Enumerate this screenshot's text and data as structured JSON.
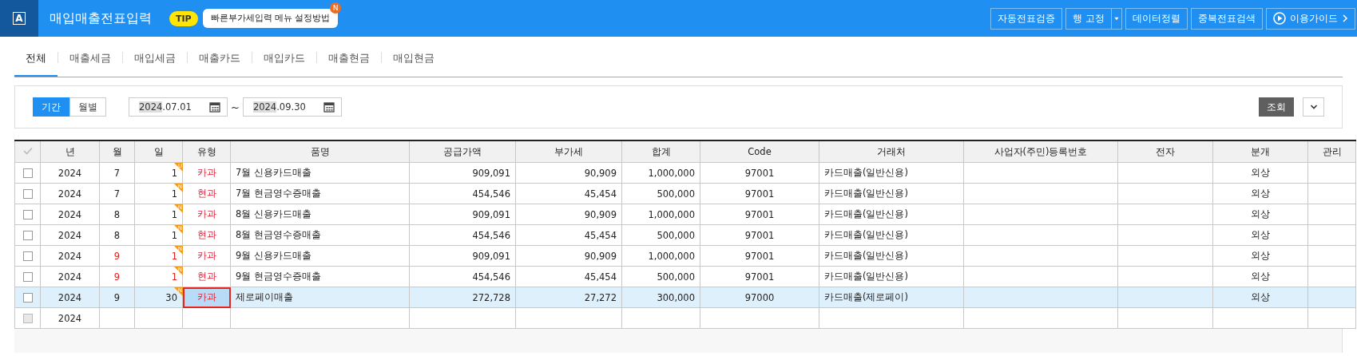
{
  "app": {
    "logo": "A",
    "title": "매입매출전표입력",
    "tip_badge": "TIP",
    "tip_text": "빠른부가세입력 메뉴 설정방법",
    "tip_new": "N"
  },
  "toolbar": [
    {
      "label": "자동전표검증",
      "kind": "button"
    },
    {
      "label": "행 고정",
      "kind": "split"
    },
    {
      "label": "데이터정렬",
      "kind": "button"
    },
    {
      "label": "중복전표검색",
      "kind": "button"
    },
    {
      "label": "이용가이드",
      "kind": "guide"
    }
  ],
  "tabs": [
    {
      "label": "전체",
      "selected": true
    },
    {
      "label": "매출세금",
      "selected": false
    },
    {
      "label": "매입세금",
      "selected": false
    },
    {
      "label": "매출카드",
      "selected": false
    },
    {
      "label": "매입카드",
      "selected": false
    },
    {
      "label": "매출현금",
      "selected": false
    },
    {
      "label": "매입현금",
      "selected": false
    }
  ],
  "period": {
    "modes": [
      {
        "label": "기간",
        "selected": true
      },
      {
        "label": "월별",
        "selected": false
      }
    ],
    "from": {
      "year": "2024",
      "rest": ".07.01"
    },
    "separator": "~",
    "to": {
      "year": "2024",
      "rest": ".09.30"
    },
    "search_button": "조회"
  },
  "table": {
    "columns": [
      "년",
      "월",
      "일",
      "유형",
      "품명",
      "공급가액",
      "부가세",
      "합계",
      "Code",
      "거래처",
      "사업자(주민)등록번호",
      "전자",
      "분개",
      "관리"
    ],
    "rows": [
      {
        "kind": "entry",
        "checked": false,
        "selected": false,
        "focused": false,
        "warn": false,
        "year": "2024",
        "month": "7",
        "day": "1",
        "flag": "U",
        "type": "카과",
        "item": "7월 신용카드매출",
        "supply": "909,091",
        "vat": "90,909",
        "total": "1,000,000",
        "code": "97001",
        "partner": "카드매출(일반신용)",
        "journal": "외상"
      },
      {
        "kind": "entry",
        "checked": false,
        "selected": false,
        "focused": false,
        "warn": false,
        "year": "2024",
        "month": "7",
        "day": "1",
        "flag": "N",
        "type": "현과",
        "item": "7월 현금영수증매출",
        "supply": "454,546",
        "vat": "45,454",
        "total": "500,000",
        "code": "97001",
        "partner": "카드매출(일반신용)",
        "journal": "외상"
      },
      {
        "kind": "entry",
        "checked": false,
        "selected": false,
        "focused": false,
        "warn": false,
        "year": "2024",
        "month": "8",
        "day": "1",
        "flag": "N",
        "type": "카과",
        "item": "8월 신용카드매출",
        "supply": "909,091",
        "vat": "90,909",
        "total": "1,000,000",
        "code": "97001",
        "partner": "카드매출(일반신용)",
        "journal": "외상"
      },
      {
        "kind": "entry",
        "checked": false,
        "selected": false,
        "focused": false,
        "warn": false,
        "year": "2024",
        "month": "8",
        "day": "1",
        "flag": "N",
        "type": "현과",
        "item": "8월 현금영수증매출",
        "supply": "454,546",
        "vat": "45,454",
        "total": "500,000",
        "code": "97001",
        "partner": "카드매출(일반신용)",
        "journal": "외상"
      },
      {
        "kind": "entry",
        "checked": false,
        "selected": false,
        "focused": false,
        "warn": true,
        "year": "2024",
        "month": "9",
        "day": "1",
        "flag": "N",
        "type": "카과",
        "item": "9월 신용카드매출",
        "supply": "909,091",
        "vat": "90,909",
        "total": "1,000,000",
        "code": "97001",
        "partner": "카드매출(일반신용)",
        "journal": "외상"
      },
      {
        "kind": "entry",
        "checked": false,
        "selected": false,
        "focused": false,
        "warn": true,
        "year": "2024",
        "month": "9",
        "day": "1",
        "flag": "N",
        "type": "현과",
        "item": "9월 현금영수증매출",
        "supply": "454,546",
        "vat": "45,454",
        "total": "500,000",
        "code": "97001",
        "partner": "카드매출(일반신용)",
        "journal": "외상"
      },
      {
        "kind": "entry",
        "checked": false,
        "selected": true,
        "focused": true,
        "warn": false,
        "year": "2024",
        "month": "9",
        "day": "30",
        "flag": "N",
        "type": "카과",
        "item": "제로페이매출",
        "supply": "272,728",
        "vat": "27,272",
        "total": "300,000",
        "code": "97000",
        "partner": "카드매출(제로페이)",
        "journal": "외상"
      },
      {
        "kind": "new",
        "checked": false,
        "year": "2024"
      }
    ]
  }
}
